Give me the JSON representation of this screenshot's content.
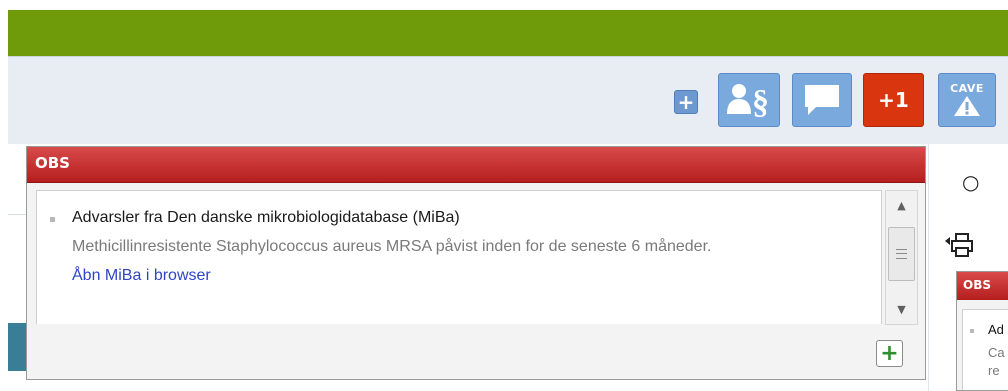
{
  "toolbar": {
    "obs_count_label": "+1",
    "cave_label": "CAVE",
    "small_add_label": "+",
    "colors": {
      "green_bar": "#6f9a09",
      "button_blue": "#7aa9de",
      "obs_red": "#d9350e"
    },
    "icons": [
      "plus-icon",
      "person-paragraph-icon",
      "speech-bubble-icon",
      "warning-triangle-icon"
    ]
  },
  "popup": {
    "title": "OBS",
    "item": {
      "title": "Advarsler fra Den danske mikrobiologidatabase (MiBa)",
      "description": "Methicillinresistente Staphylococcus aureus MRSA påvist inden for de seneste 6 måneder.",
      "link": "Åbn MiBa i browser"
    },
    "add_label": "+"
  },
  "side": {
    "drop_icon": "○",
    "mini_popup": {
      "title": "OBS",
      "item_title": "Ad",
      "desc_line1": "Ca",
      "desc_line2": "re"
    }
  }
}
